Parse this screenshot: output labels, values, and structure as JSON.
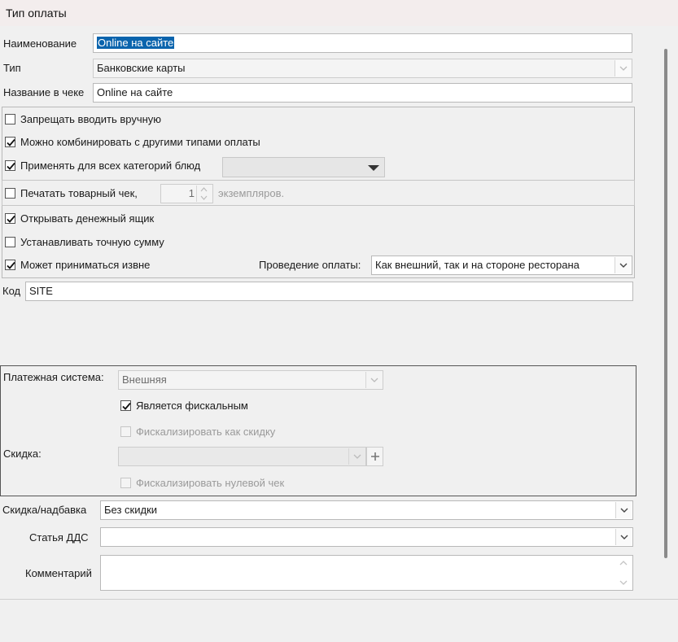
{
  "window": {
    "title": "Тип оплаты"
  },
  "form": {
    "name_label": "Наименование",
    "name_value": "Online на сайте",
    "type_label": "Тип",
    "type_value": "Банковские карты",
    "receipt_name_label": "Название в чеке",
    "receipt_name_value": "Online на сайте",
    "code_label": "Код",
    "code_value": "SITE"
  },
  "options": {
    "forbid_manual": {
      "label": "Запрещать вводить вручную",
      "checked": false
    },
    "combine": {
      "label": "Можно комбинировать с другими типами оплаты",
      "checked": true
    },
    "all_categories": {
      "label": "Применять для всех категорий блюд",
      "checked": true,
      "select_value": ""
    },
    "print_receipt": {
      "label": "Печатать товарный чек,",
      "checked": false,
      "copies": "1",
      "copies_suffix": "экземпляров."
    },
    "open_drawer": {
      "label": "Открывать денежный ящик",
      "checked": true
    },
    "exact_amount": {
      "label": "Устанавливать точную сумму",
      "checked": false
    },
    "external": {
      "label": "Может приниматься извне",
      "checked": true
    },
    "processing_label": "Проведение оплаты:",
    "processing_value": "Как внешний, так и на стороне ресторана"
  },
  "payment_system": {
    "label": "Платежная система:",
    "value": "Внешняя",
    "fiscal": {
      "label": "Является фискальным",
      "checked": true
    },
    "fiscal_discount": {
      "label": "Фискализировать как скидку",
      "checked": false
    },
    "discount_label": "Скидка:",
    "discount_value": "",
    "fiscal_zero": {
      "label": "Фискализировать нулевой чек",
      "checked": false
    }
  },
  "extra": {
    "discount_surcharge_label": "Скидка/надбавка",
    "discount_surcharge_value": "Без скидки",
    "cashflow_label": "Статья ДДС",
    "cashflow_value": "",
    "comment_label": "Комментарий",
    "comment_value": ""
  },
  "icons": {
    "dropdown": "chevron-down-icon",
    "check": "check-icon",
    "spin_up": "chevron-up-icon",
    "spin_down": "chevron-down-icon",
    "plus": "plus-icon"
  },
  "colors": {
    "selection": "#0a64ad",
    "background": "#f0f0f0",
    "titlebar": "#f3eded"
  }
}
